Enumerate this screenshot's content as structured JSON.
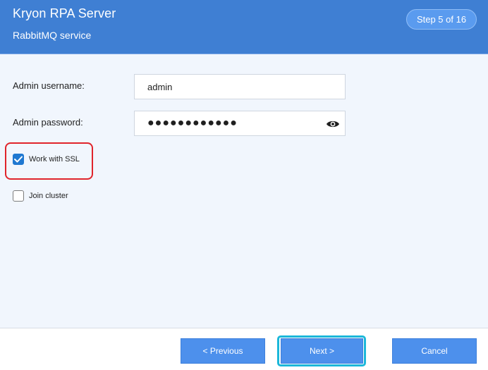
{
  "header": {
    "title": "Kryon RPA Server",
    "subtitle": "RabbitMQ service",
    "step_badge": "Step 5 of 16"
  },
  "form": {
    "username": {
      "label": "Admin username:",
      "value": "admin"
    },
    "password": {
      "label": "Admin password:",
      "value": "●●●●●●●●●●●●",
      "icon": "eye-icon"
    },
    "ssl": {
      "label": "Work with SSL",
      "checked": true
    },
    "cluster": {
      "label": "Join cluster",
      "checked": false
    }
  },
  "footer": {
    "previous_label": "< Previous",
    "next_label": "Next >",
    "cancel_label": "Cancel"
  },
  "colors": {
    "header_bg": "#3f7fd3",
    "content_bg": "#f1f6fd",
    "button_bg": "#4d90ec",
    "checkbox_checked": "#1f78d1",
    "highlight_red": "#e0242b",
    "highlight_cyan": "#1bb7d9"
  }
}
